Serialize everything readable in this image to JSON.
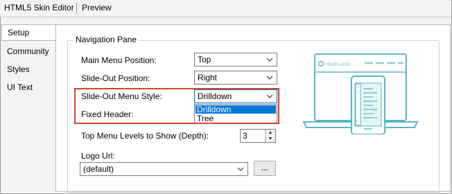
{
  "menubar": {
    "app_title": "HTML5 Skin Editor",
    "preview_label": "Preview"
  },
  "tabs": [
    "Setup",
    "Community",
    "Styles",
    "UI Text"
  ],
  "navigation_pane": {
    "legend": "Navigation Pane",
    "main_menu_position": {
      "label": "Main Menu Position:",
      "value": "Top"
    },
    "slide_out_position": {
      "label": "Slide-Out Position:",
      "value": "Right"
    },
    "slide_out_menu_style": {
      "label": "Slide-Out Menu Style:",
      "value": "Drilldown",
      "options": [
        "Drilldown",
        "Tree"
      ]
    },
    "fixed_header": {
      "label": "Fixed Header:"
    },
    "top_menu_levels": {
      "label": "Top Menu Levels to Show (Depth):",
      "value": "3"
    },
    "logo_url": {
      "label": "Logo Url:",
      "value": "(default)",
      "browse_label": "..."
    }
  },
  "preview_graphic": {
    "logo_text": "YOUR LOGO",
    "accent_color": "#5ab5c6"
  },
  "colors": {
    "highlight_border": "#d9412b",
    "selection": "#0078d7"
  }
}
